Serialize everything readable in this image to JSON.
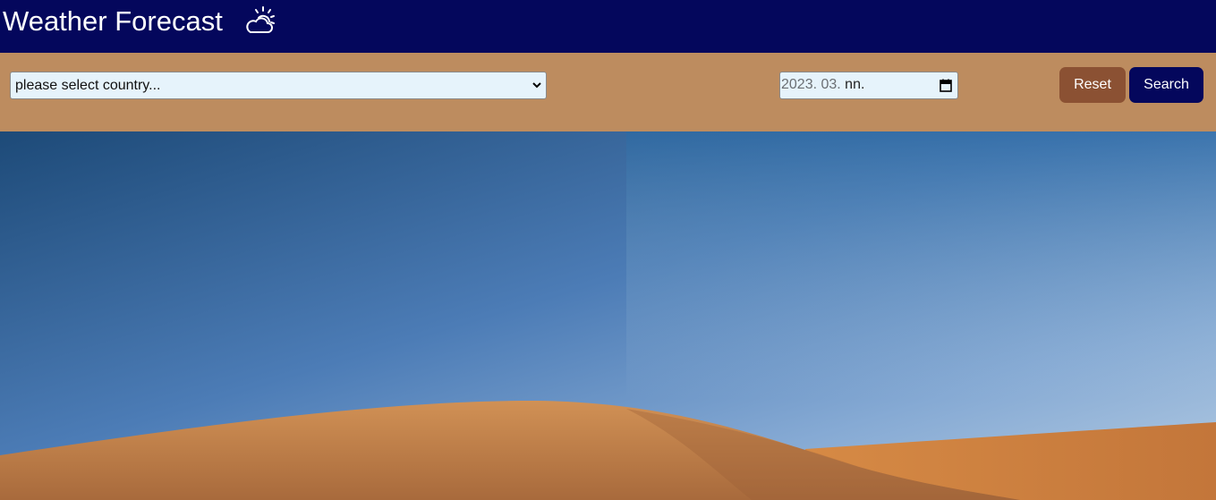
{
  "header": {
    "title": "Weather Forecast",
    "icon": "cloud-sun-icon",
    "background": "#04075c"
  },
  "toolbar": {
    "background": "#bd8c5f",
    "country_select": {
      "selected": "please select country...",
      "icon": "chevron-down-icon"
    },
    "date_input": {
      "value_prefix": "2023. 03.",
      "value_suffix": " nn.",
      "icon": "calendar-icon"
    },
    "reset_label": "Reset",
    "reset_color": "#8b5133",
    "search_label": "Search",
    "search_color": "#04075c"
  },
  "hero": {
    "description_icon": "desert-dunes-background"
  }
}
